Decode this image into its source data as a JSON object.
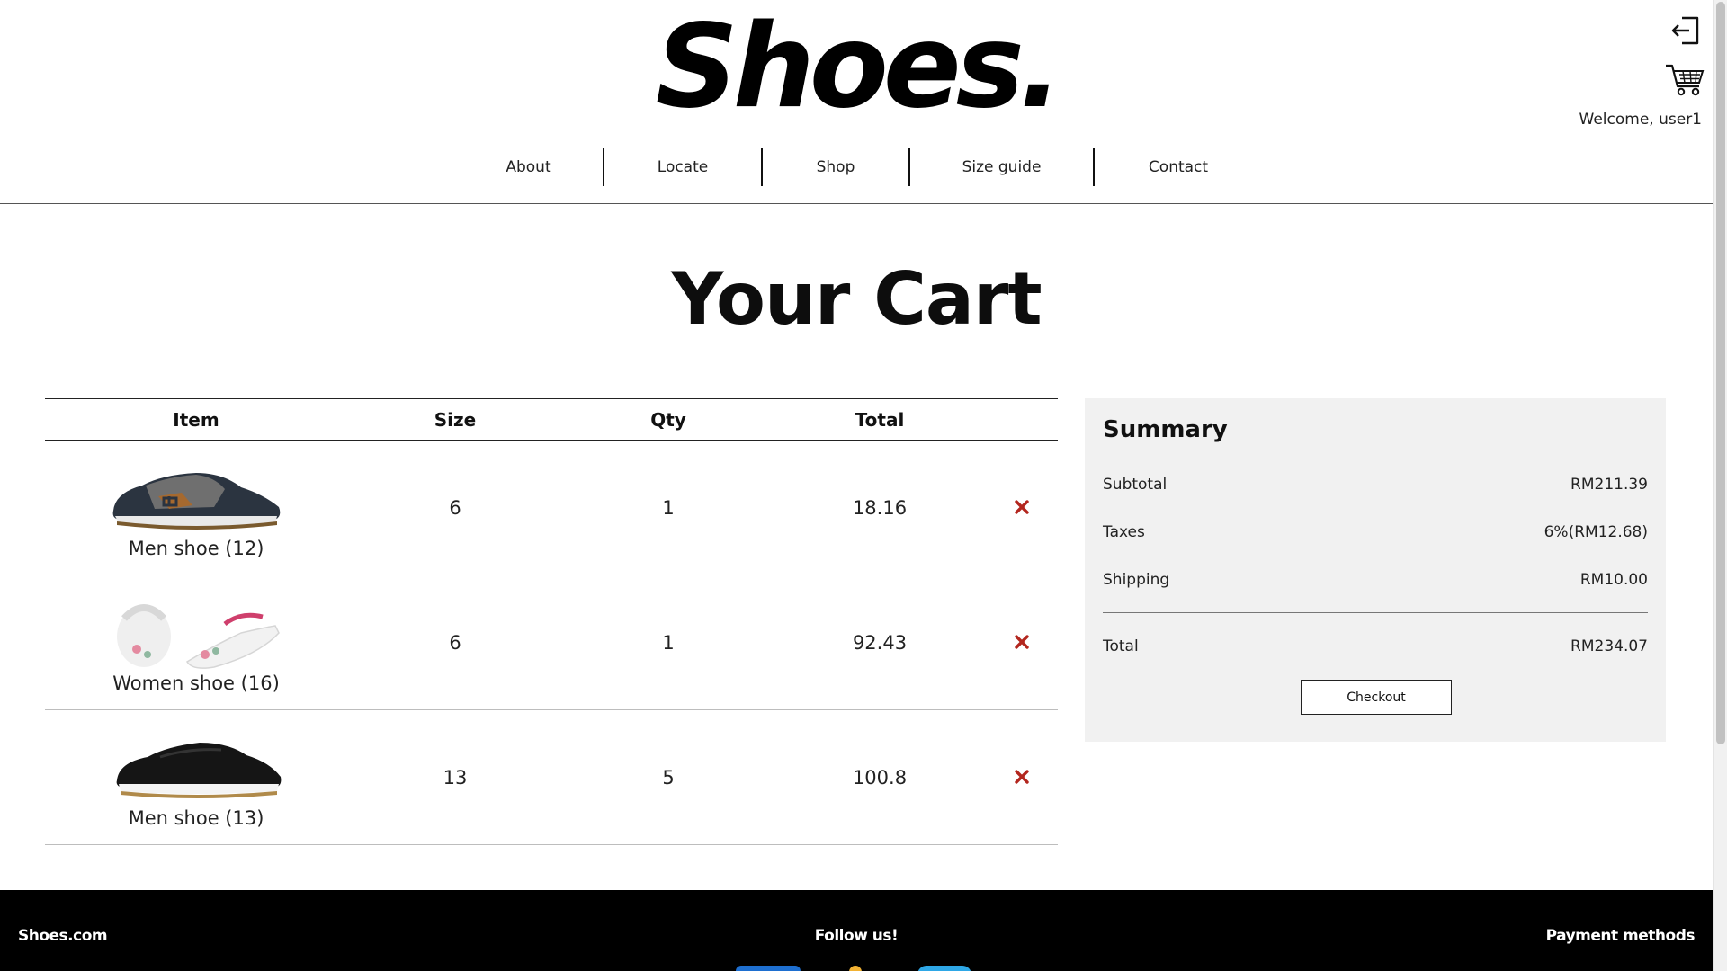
{
  "header": {
    "logo": "Shoes.",
    "welcome": "Welcome, user1",
    "nav": [
      "About",
      "Locate",
      "Shop",
      "Size guide",
      "Contact"
    ]
  },
  "page_title": "Your Cart",
  "table": {
    "headers": [
      "Item",
      "Size",
      "Qty",
      "Total"
    ],
    "rows": [
      {
        "name": "Men shoe (12)",
        "size": "6",
        "qty": "1",
        "total": "18.16"
      },
      {
        "name": "Women shoe (16)",
        "size": "6",
        "qty": "1",
        "total": "92.43"
      },
      {
        "name": "Men shoe (13)",
        "size": "13",
        "qty": "5",
        "total": "100.8"
      }
    ]
  },
  "summary": {
    "title": "Summary",
    "subtotal_label": "Subtotal",
    "subtotal_value": "RM211.39",
    "taxes_label": "Taxes",
    "taxes_value": "6%(RM12.68)",
    "shipping_label": "Shipping",
    "shipping_value": "RM10.00",
    "total_label": "Total",
    "total_value": "RM234.07",
    "checkout_label": "Checkout"
  },
  "footer": {
    "brand": "Shoes.com",
    "follow": "Follow us!",
    "payment": "Payment methods"
  },
  "colors": {
    "delete": "#b3261e",
    "footer_bg": "#000000",
    "summary_bg": "#f1f1f1"
  },
  "icons": {
    "logout": "logout-icon",
    "cart": "cart-icon",
    "delete": "close-x-icon"
  }
}
